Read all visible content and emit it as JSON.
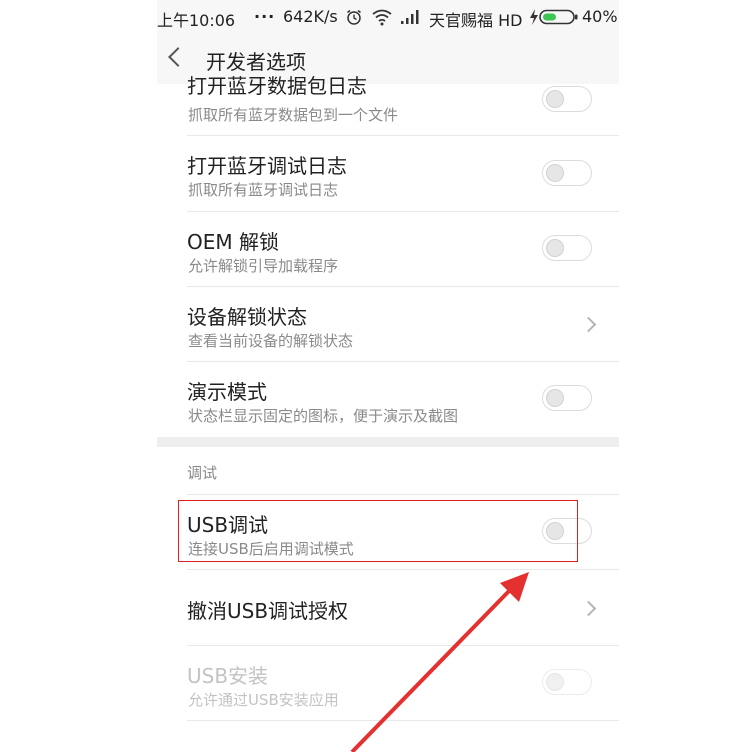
{
  "status_bar": {
    "time": "上午10:06",
    "dots": "...",
    "speed": "642K/s",
    "carrier": "天官赐福 HD",
    "battery": "40%",
    "icons": [
      "alarm-icon",
      "wifi-icon",
      "signal-icon",
      "charging-icon",
      "battery-icon"
    ]
  },
  "nav": {
    "title": "开发者选项",
    "back_icon": "chevron-left-icon"
  },
  "settings": [
    {
      "title": "打开蓝牙数据包日志",
      "subtitle": "抓取所有蓝牙数据包到一个文件",
      "control": "toggle",
      "on": false
    },
    {
      "title": "打开蓝牙调试日志",
      "subtitle": "抓取所有蓝牙调试日志",
      "control": "toggle",
      "on": false
    },
    {
      "title": "OEM 解锁",
      "subtitle": "允许解锁引导加载程序",
      "control": "toggle",
      "on": false
    },
    {
      "title": "设备解锁状态",
      "subtitle": "查看当前设备的解锁状态",
      "control": "chevron"
    },
    {
      "title": "演示模式",
      "subtitle": "状态栏显示固定的图标，便于演示及截图",
      "control": "toggle",
      "on": false
    }
  ],
  "debug_section": {
    "header": "调试",
    "items": [
      {
        "title": "USB调试",
        "subtitle": "连接USB后启用调试模式",
        "control": "toggle",
        "on": false,
        "highlighted": true
      },
      {
        "title": "撤消USB调试授权",
        "subtitle": "",
        "control": "chevron"
      },
      {
        "title": "USB安装",
        "subtitle": "允许通过USB安装应用",
        "control": "toggle",
        "on": false,
        "disabled": true
      }
    ]
  },
  "colors": {
    "annotation": "#e02020",
    "accent_arrow": "#e53030",
    "subtitle": "#8a8a8a"
  }
}
